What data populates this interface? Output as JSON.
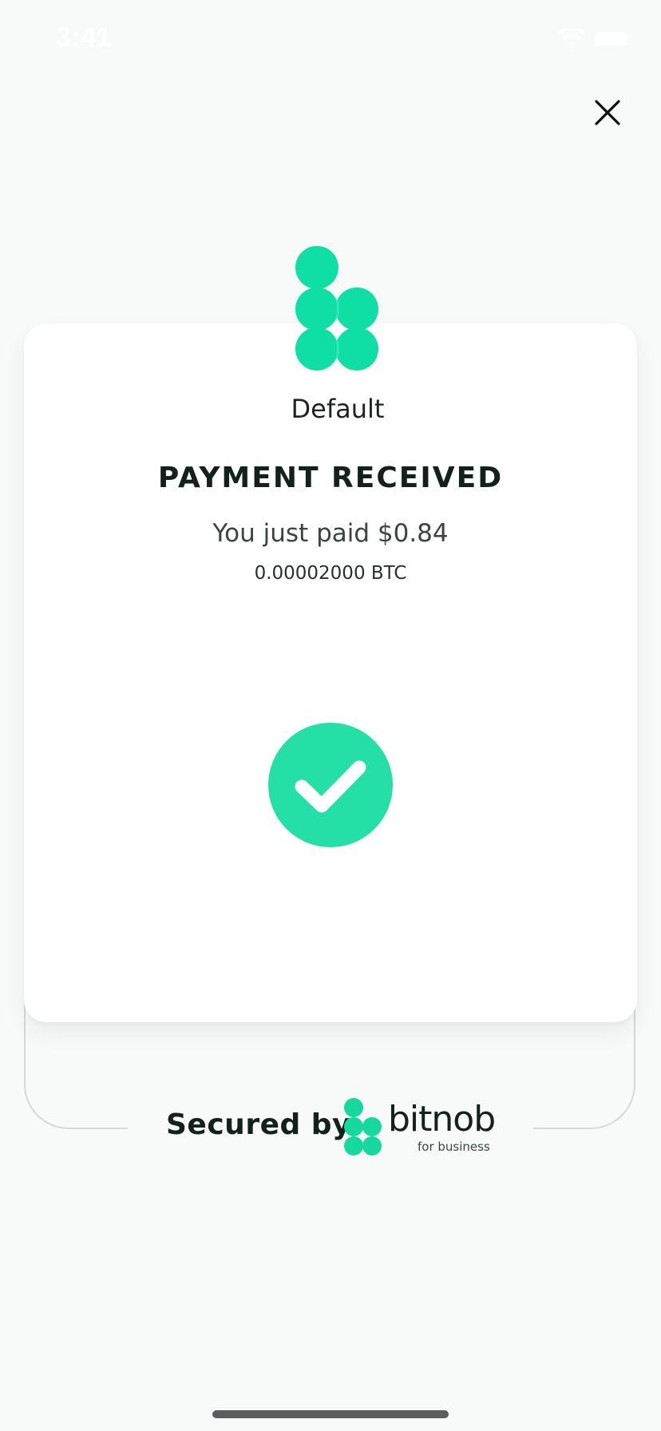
{
  "status_bar": {
    "time": "3:41",
    "wifi_icon": "wifi-icon",
    "battery_icon": "battery-icon"
  },
  "close_icon": "close-icon",
  "merchant": {
    "name": "Default",
    "logo_color": "#0fdfa5"
  },
  "payment": {
    "title": "PAYMENT RECEIVED",
    "amount_text": "You just paid $0.84",
    "btc_text": "0.00002000 BTC",
    "status_icon": "checkmark-circle-icon",
    "success_color": "#25e0a6"
  },
  "footer": {
    "secured_label": "Secured by",
    "brand_name": "bitnob",
    "brand_tagline": "for business"
  },
  "colors": {
    "background": "#f8f9f9",
    "card": "#ffffff",
    "text_dark": "#13211d",
    "accent": "#0fdfa5"
  }
}
